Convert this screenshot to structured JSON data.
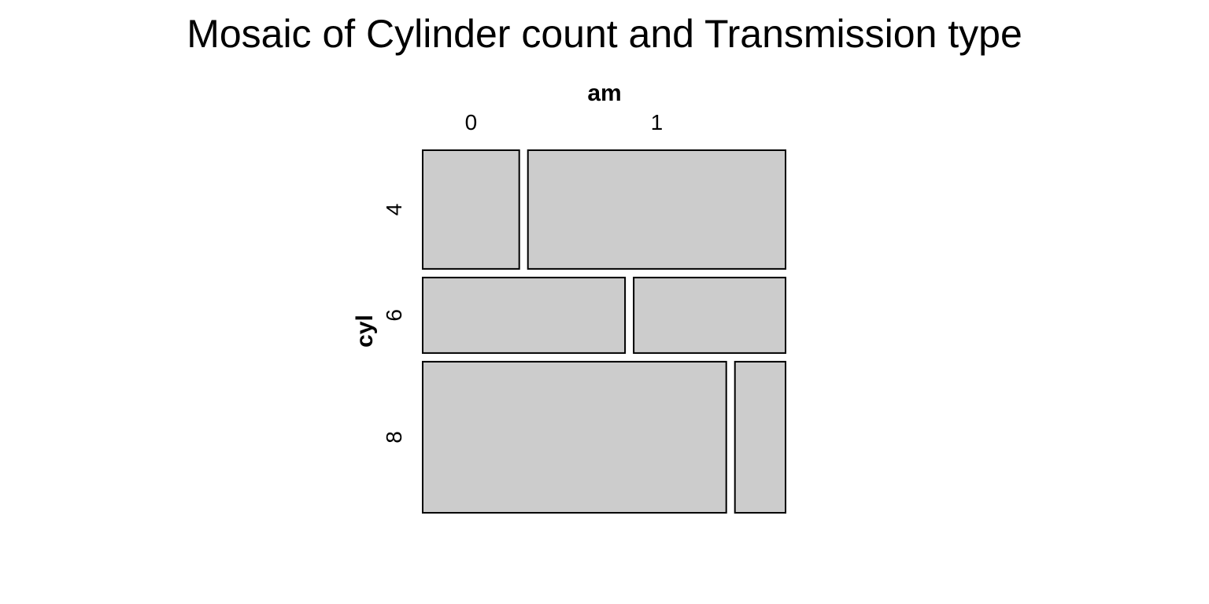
{
  "chart_data": {
    "type": "mosaic",
    "title": "Mosaic of Cylinder count and Transmission type",
    "xlabel": "am",
    "ylabel": "cyl",
    "row_categories": [
      "4",
      "6",
      "8"
    ],
    "col_categories": [
      "0",
      "1"
    ],
    "counts": [
      [
        3,
        8
      ],
      [
        4,
        3
      ],
      [
        12,
        2
      ]
    ],
    "tile_color": "#cccccc",
    "border_color": "#000000"
  }
}
